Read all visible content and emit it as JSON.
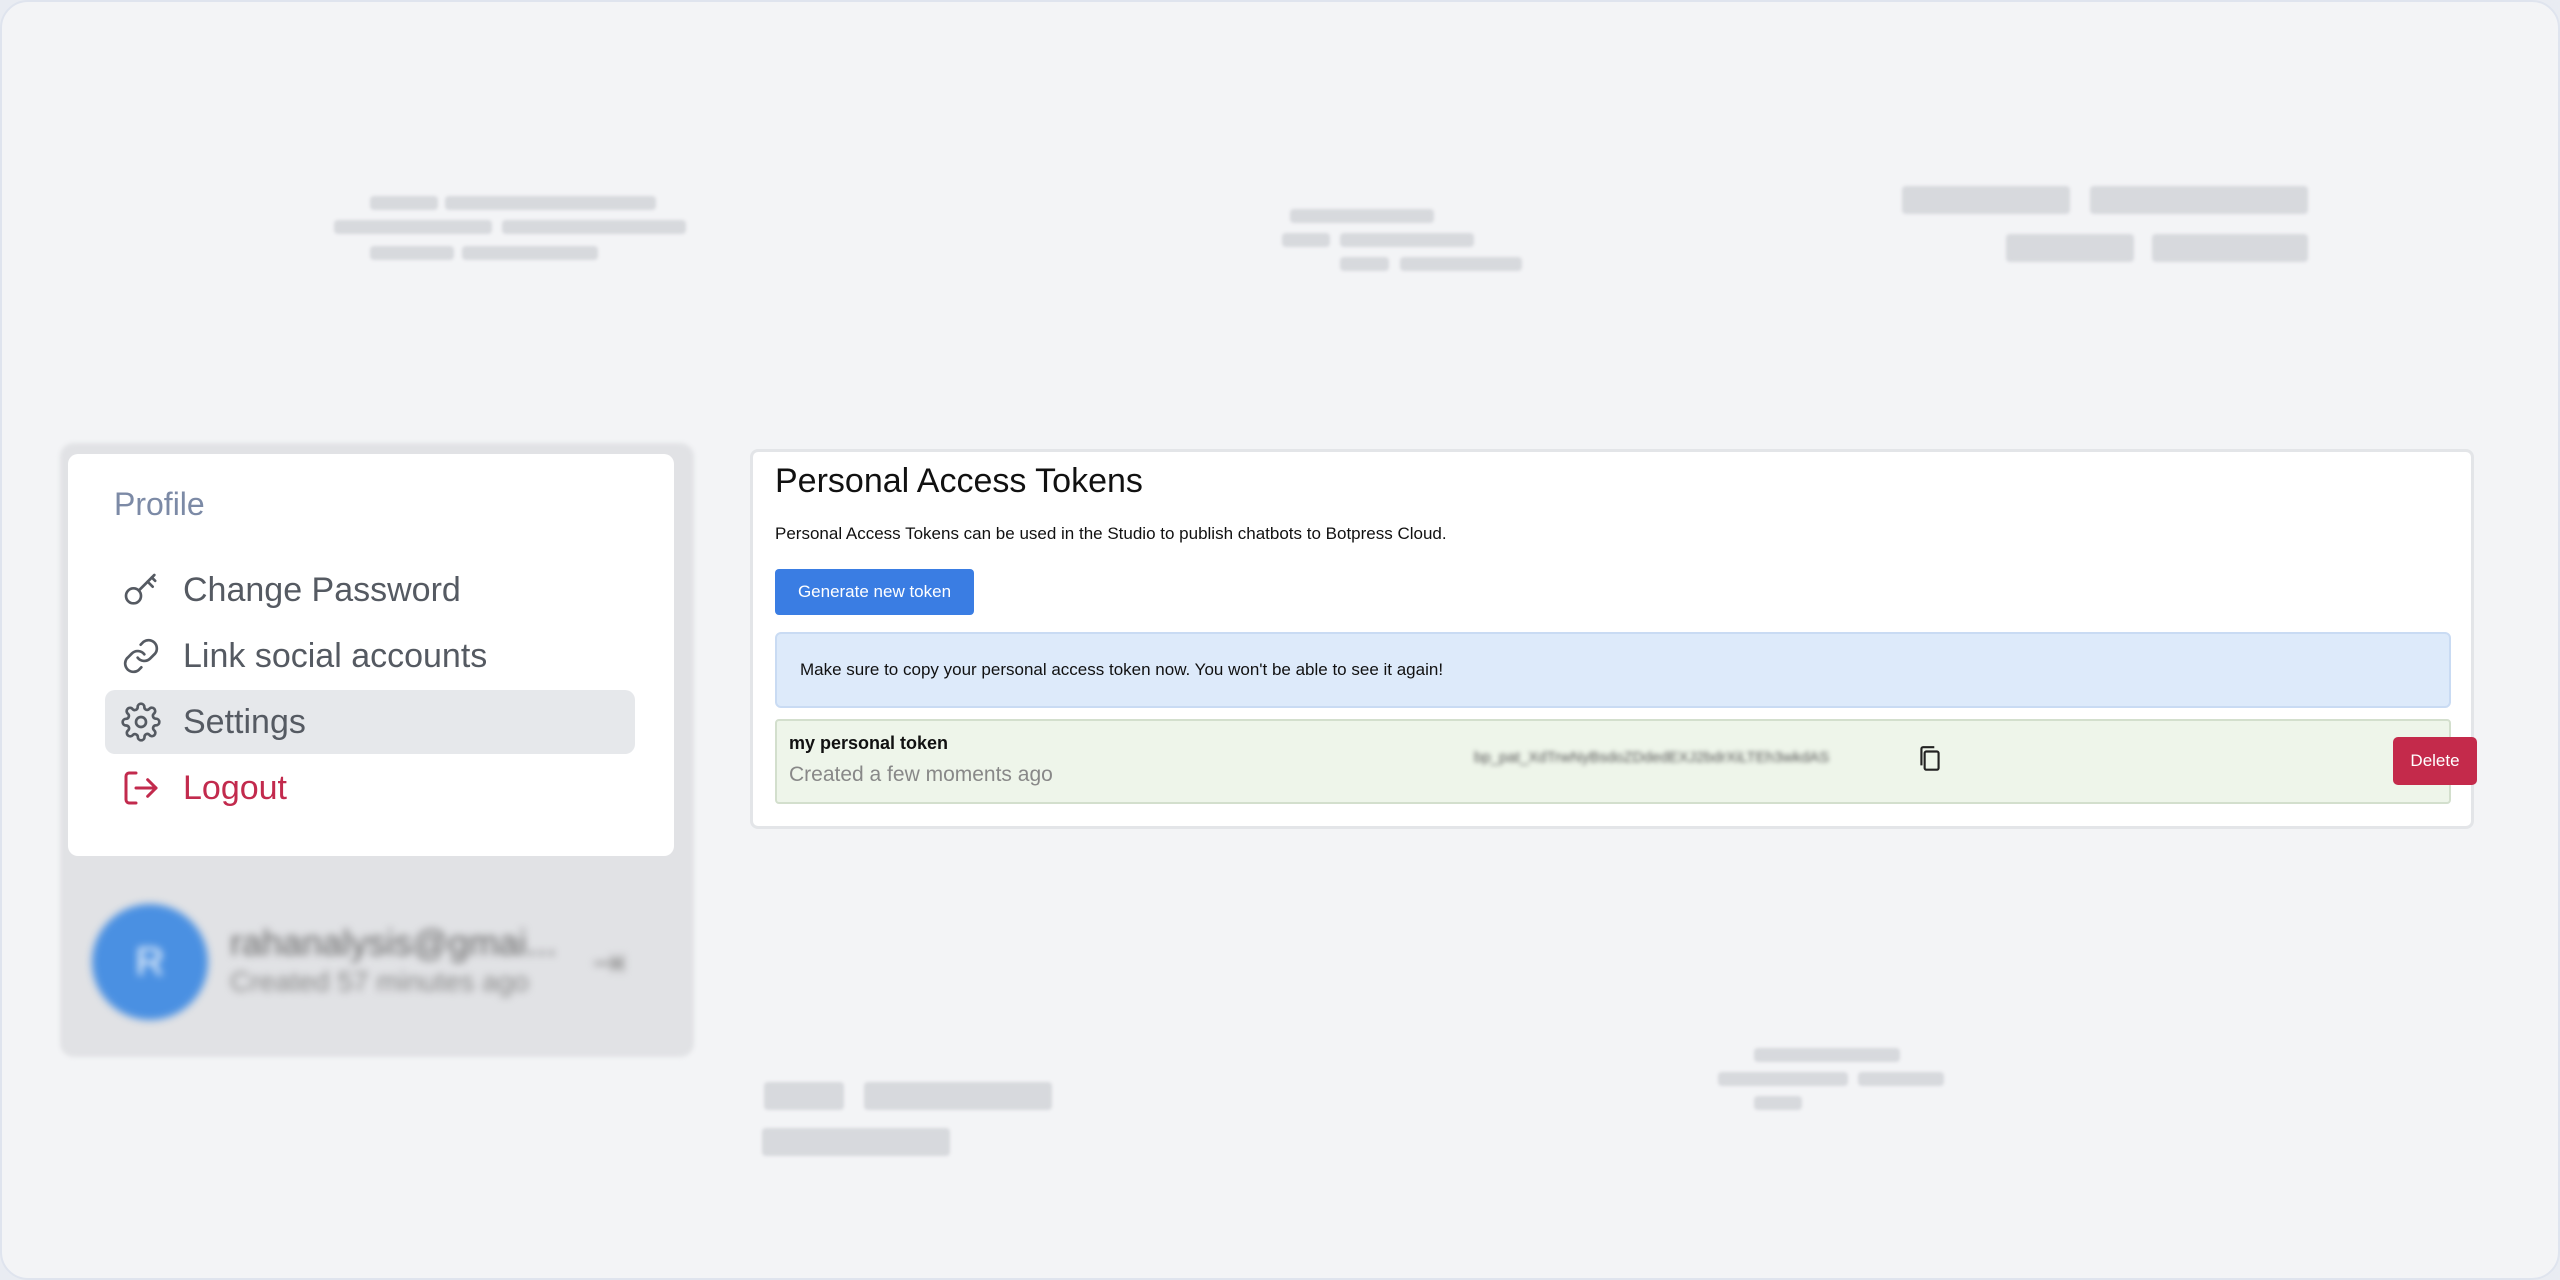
{
  "menu": {
    "title": "Profile",
    "items": [
      {
        "label": "Change Password",
        "icon": "key-icon"
      },
      {
        "label": "Link social accounts",
        "icon": "link-icon"
      },
      {
        "label": "Settings",
        "icon": "gear-icon",
        "active": true
      },
      {
        "label": "Logout",
        "icon": "logout-icon"
      }
    ]
  },
  "account": {
    "avatar_initial": "R",
    "email": "rahanalysis@gmai...",
    "created": "Created 57 minutes ago"
  },
  "tokens": {
    "title": "Personal Access Tokens",
    "description": "Personal Access Tokens can be used in the Studio to publish chatbots to Botpress Cloud.",
    "generate_label": "Generate new token",
    "notice": "Make sure to copy your personal access token now. You won't be able to see it again!",
    "token": {
      "name": "my personal token",
      "created": "Created a few moments ago",
      "value": "bp_pat_XdTrwNyBsdoZDdedEXJ2bdrXiLTEh3wkdAS",
      "delete_label": "Delete"
    }
  },
  "colors": {
    "accent": "#3a7de3",
    "danger": "#c42a4b",
    "notice_bg": "#ddeafa",
    "token_row_bg": "#eef5ea"
  }
}
